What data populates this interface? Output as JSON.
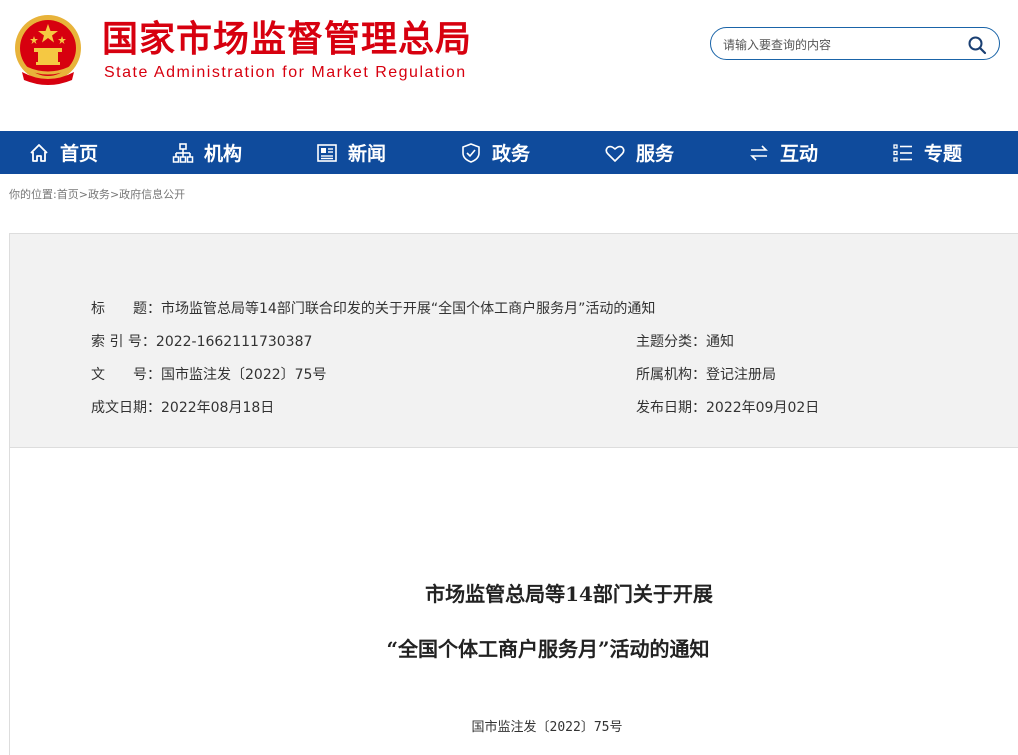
{
  "header": {
    "title": "国家市场监督管理总局",
    "subtitle": "State Administration for Market Regulation"
  },
  "search": {
    "placeholder": "请输入要查询的内容",
    "value": ""
  },
  "nav": {
    "items": [
      {
        "label": "首页",
        "icon": "home-icon"
      },
      {
        "label": "机构",
        "icon": "org-chart-icon"
      },
      {
        "label": "新闻",
        "icon": "newspaper-icon"
      },
      {
        "label": "政务",
        "icon": "shield-icon"
      },
      {
        "label": "服务",
        "icon": "heart-icon"
      },
      {
        "label": "互动",
        "icon": "exchange-icon"
      },
      {
        "label": "专题",
        "icon": "list-icon"
      }
    ]
  },
  "breadcrumb": {
    "prefix": "你的位置:",
    "items": [
      "首页",
      "政务",
      "政府信息公开"
    ],
    "separator": ">"
  },
  "info": {
    "title_label": "标　　题：",
    "title_value": "市场监管总局等14部门联合印发的关于开展“全国个体工商户服务月”活动的通知",
    "index_label": "索 引 号：",
    "index_value": "2022-1662111730387",
    "category_label": "主题分类：",
    "category_value": "通知",
    "docno_label": "文　　号：",
    "docno_value": "国市监注发〔2022〕75号",
    "org_label": "所属机构：",
    "org_value": "登记注册局",
    "written_label": "成文日期：",
    "written_value": "2022年08月18日",
    "published_label": "发布日期：",
    "published_value": "2022年09月02日"
  },
  "document": {
    "title_line1": "市场监管总局等14部门关于开展",
    "title_line2": "“全国个体工商户服务月”活动的通知",
    "number": "国市监注发〔2022〕75号"
  },
  "colors": {
    "brand_red": "#d7000f",
    "nav_blue": "#0f4b9c",
    "info_bg": "#f2f2f2"
  }
}
